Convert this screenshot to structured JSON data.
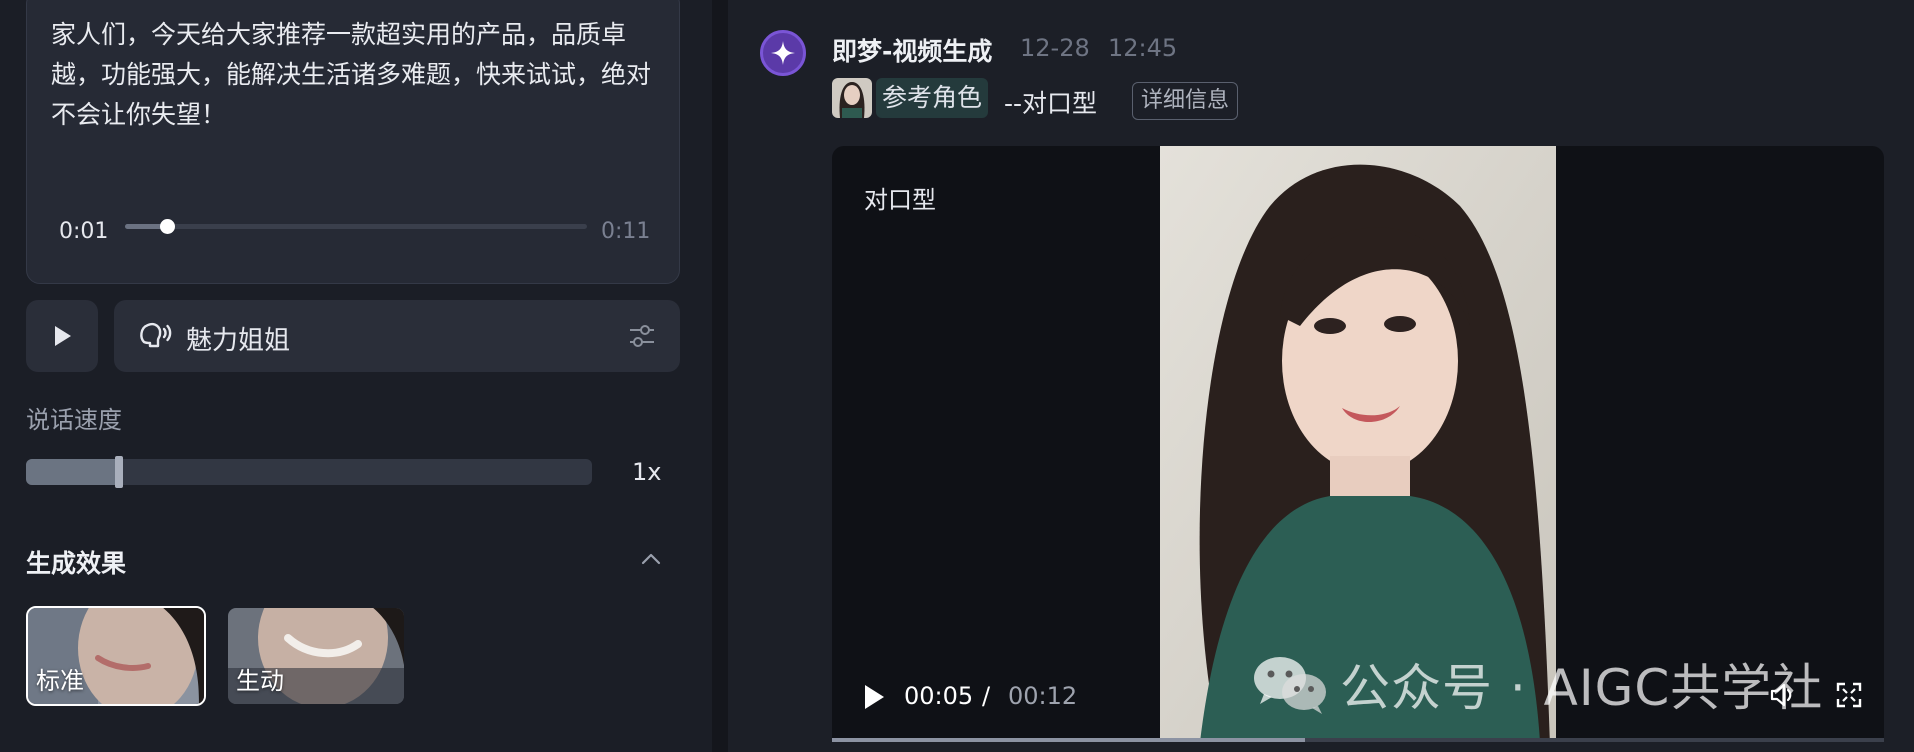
{
  "left_panel": {
    "script": {
      "text": "家人们，今天给大家推荐一款超实用的产品，品质卓越，功能强大，能解决生活诸多难题，快来试试，绝对不会让你失望！",
      "audio_current": "0:01",
      "audio_total": "0:11",
      "audio_progress": 0.09
    },
    "voice": {
      "label": "魅力姐姐"
    },
    "speed": {
      "title": "说话速度",
      "value_label": "1x",
      "fraction": 0.165
    },
    "effect": {
      "title": "生成效果",
      "options": [
        {
          "label": "标准",
          "selected": true
        },
        {
          "label": "生动",
          "selected": false
        }
      ]
    }
  },
  "right_panel": {
    "bot": {
      "name": "即梦-视频生成",
      "date": "12-28",
      "time": "12:45"
    },
    "reference": {
      "chip_label": "参考角色",
      "type_label": "--对口型",
      "detail_button": "详细信息"
    },
    "video": {
      "overlay_label": "对口型",
      "current_time": "00:05",
      "separator": "/",
      "total_time": "00:12",
      "progress": 0.45
    },
    "watermark": "公众号 · AIGC共学社"
  },
  "colors": {
    "accent_purple": "#5b3aa8",
    "chip_teal": "#243a3c",
    "panel_bg": "#1b1e26"
  }
}
